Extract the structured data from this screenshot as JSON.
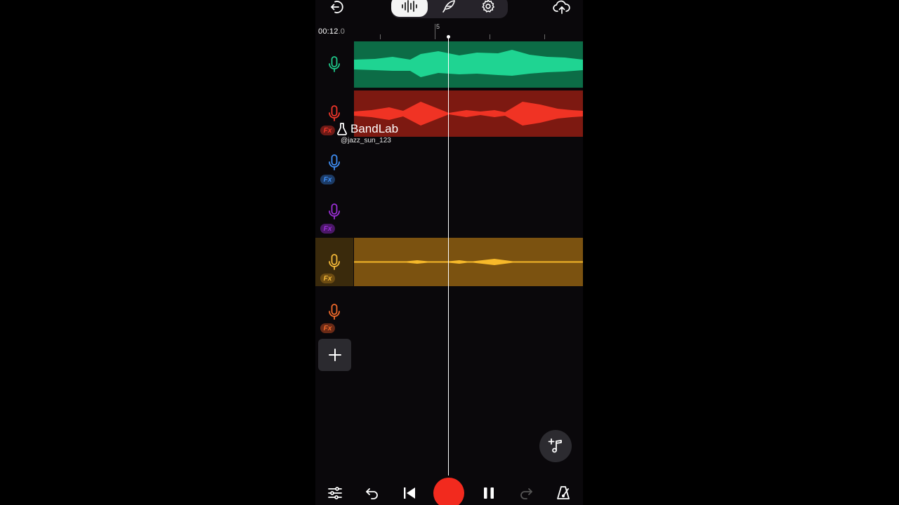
{
  "header": {
    "back_icon": "exit-arrow-icon",
    "tabs": [
      {
        "icon": "waveform-icon",
        "active": true
      },
      {
        "icon": "quill-icon",
        "active": false
      },
      {
        "icon": "gear-icon",
        "active": false
      }
    ],
    "upload_icon": "cloud-upload-icon"
  },
  "timeline": {
    "time_main": "00:12",
    "time_fraction": ".0",
    "ruler_label": "5"
  },
  "tracks": [
    {
      "color": "#1fc98a",
      "clip_bg": "#0c6c46",
      "wave": "#1fd492",
      "fx": false,
      "fx_bg": ""
    },
    {
      "color": "#f0362a",
      "clip_bg": "#7d1911",
      "wave": "#f03324",
      "fx": true,
      "fx_bg": "#6e1a16"
    },
    {
      "color": "#3f8ef5",
      "clip_bg": "",
      "wave": "",
      "fx": true,
      "fx_bg": "#1c3b66"
    },
    {
      "color": "#9b2fd6",
      "clip_bg": "",
      "wave": "",
      "fx": true,
      "fx_bg": "#4b1768"
    },
    {
      "color": "#f5b938",
      "clip_bg": "#7b5210",
      "wave": "#f7b92a",
      "fx": true,
      "fx_bg": "#6d4c12",
      "selected": true
    },
    {
      "color": "#f06a2a",
      "clip_bg": "",
      "wave": "",
      "fx": true,
      "fx_bg": "#6a2a16"
    }
  ],
  "fx_label": "Fx",
  "watermark": {
    "brand": "BandLab",
    "user": "@jazz_sun_123"
  },
  "add_track_icon": "plus-icon",
  "add_sample_icon": "music-note-plus-icon",
  "transport": {
    "icons": [
      "mixer-sliders-icon",
      "undo-icon",
      "skip-to-start-icon",
      "record-icon",
      "pause-icon",
      "redo-icon",
      "metronome-icon"
    ],
    "record_color": "#f22a1e"
  }
}
